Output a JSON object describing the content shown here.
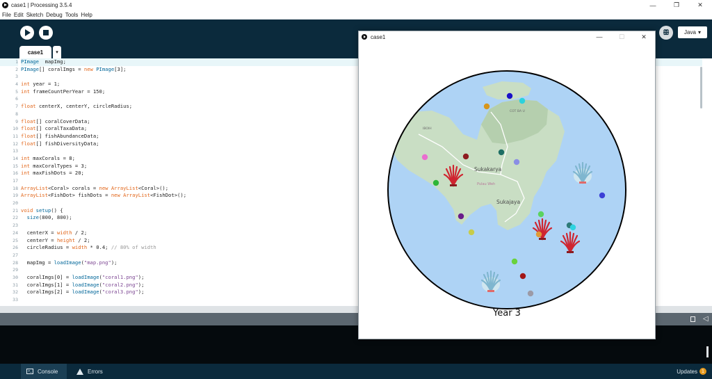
{
  "window": {
    "title": "case1 | Processing 3.5.4",
    "minimize_glyph": "—",
    "maximize_glyph": "❐",
    "close_glyph": "✕"
  },
  "menu": [
    "File",
    "Edit",
    "Sketch",
    "Debug",
    "Tools",
    "Help"
  ],
  "toolbar": {
    "run_icon": "play-icon",
    "stop_icon": "stop-icon",
    "debug_icon": "butterfly-icon",
    "mode_label": "Java",
    "mode_arrow": "▾"
  },
  "tabs": {
    "active": "case1",
    "menu_arrow": "▾"
  },
  "editor": {
    "current_line": 1,
    "lines": [
      {
        "n": "1",
        "s": [
          [
            "kw2",
            "PImage"
          ],
          [
            "",
            "  mapImg;"
          ]
        ]
      },
      {
        "n": "2",
        "s": [
          [
            "kw2",
            "PImage"
          ],
          [
            "",
            "[] coralImgs = "
          ],
          [
            "kw",
            "new"
          ],
          [
            "",
            " "
          ],
          [
            "kw2",
            "PImage"
          ],
          [
            "",
            "[3];"
          ]
        ]
      },
      {
        "n": "3",
        "s": []
      },
      {
        "n": "4",
        "s": [
          [
            "kw",
            "int"
          ],
          [
            "",
            " year = 1;"
          ]
        ]
      },
      {
        "n": "5",
        "s": [
          [
            "kw",
            "int"
          ],
          [
            "",
            " frameCountPerYear = 150;"
          ]
        ]
      },
      {
        "n": "6",
        "s": []
      },
      {
        "n": "7",
        "s": [
          [
            "kw",
            "float"
          ],
          [
            "",
            " centerX, centerY, circleRadius;"
          ]
        ]
      },
      {
        "n": "8",
        "s": []
      },
      {
        "n": "9",
        "s": [
          [
            "kw",
            "float"
          ],
          [
            "",
            "[] coralCoverData;"
          ]
        ]
      },
      {
        "n": "10",
        "s": [
          [
            "kw",
            "float"
          ],
          [
            "",
            "[] coralTaxaData;"
          ]
        ]
      },
      {
        "n": "11",
        "s": [
          [
            "kw",
            "float"
          ],
          [
            "",
            "[] fishAbundanceData;"
          ]
        ]
      },
      {
        "n": "12",
        "s": [
          [
            "kw",
            "float"
          ],
          [
            "",
            "[] fishDiversityData;"
          ]
        ]
      },
      {
        "n": "13",
        "s": []
      },
      {
        "n": "14",
        "s": [
          [
            "kw",
            "int"
          ],
          [
            "",
            " maxCorals = 8;"
          ]
        ]
      },
      {
        "n": "15",
        "s": [
          [
            "kw",
            "int"
          ],
          [
            "",
            " maxCoralTypes = 3;"
          ]
        ]
      },
      {
        "n": "16",
        "s": [
          [
            "kw",
            "int"
          ],
          [
            "",
            " maxFishDots = 20;"
          ]
        ]
      },
      {
        "n": "17",
        "s": []
      },
      {
        "n": "18",
        "s": [
          [
            "kw",
            "ArrayList"
          ],
          [
            "",
            "<Coral> corals = "
          ],
          [
            "kw",
            "new"
          ],
          [
            "",
            " "
          ],
          [
            "kw",
            "ArrayList"
          ],
          [
            "",
            "<Coral>();"
          ]
        ]
      },
      {
        "n": "19",
        "s": [
          [
            "kw",
            "ArrayList"
          ],
          [
            "",
            "<FishDot> fishDots = "
          ],
          [
            "kw",
            "new"
          ],
          [
            "",
            " "
          ],
          [
            "kw",
            "ArrayList"
          ],
          [
            "",
            "<FishDot>();"
          ]
        ]
      },
      {
        "n": "20",
        "s": []
      },
      {
        "n": "21",
        "s": [
          [
            "kw",
            "void"
          ],
          [
            "",
            " "
          ],
          [
            "fn",
            "setup"
          ],
          [
            "",
            "() {"
          ]
        ]
      },
      {
        "n": "22",
        "s": [
          [
            "",
            "  "
          ],
          [
            "fn",
            "size"
          ],
          [
            "",
            "(800, 800);"
          ]
        ]
      },
      {
        "n": "23",
        "s": []
      },
      {
        "n": "24",
        "s": [
          [
            "",
            "  centerX = "
          ],
          [
            "kw",
            "width"
          ],
          [
            "",
            " / 2;"
          ]
        ]
      },
      {
        "n": "25",
        "s": [
          [
            "",
            "  centerY = "
          ],
          [
            "kw",
            "height"
          ],
          [
            "",
            " / 2;"
          ]
        ]
      },
      {
        "n": "26",
        "s": [
          [
            "",
            "  circleRadius = "
          ],
          [
            "kw",
            "width"
          ],
          [
            "",
            " * 0.4; "
          ],
          [
            "cm",
            "// 80% of width"
          ]
        ]
      },
      {
        "n": "27",
        "s": []
      },
      {
        "n": "28",
        "s": [
          [
            "",
            "  mapImg = "
          ],
          [
            "fn",
            "loadImage"
          ],
          [
            "",
            "("
          ],
          [
            "str",
            "\"map.png\""
          ],
          [
            "",
            ");"
          ]
        ]
      },
      {
        "n": "29",
        "s": []
      },
      {
        "n": "30",
        "s": [
          [
            "",
            "  coralImgs[0] = "
          ],
          [
            "fn",
            "loadImage"
          ],
          [
            "",
            "("
          ],
          [
            "str",
            "\"coral1.png\""
          ],
          [
            "",
            ");"
          ]
        ]
      },
      {
        "n": "31",
        "s": [
          [
            "",
            "  coralImgs[1] = "
          ],
          [
            "fn",
            "loadImage"
          ],
          [
            "",
            "("
          ],
          [
            "str",
            "\"coral2.png\""
          ],
          [
            "",
            ");"
          ]
        ]
      },
      {
        "n": "32",
        "s": [
          [
            "",
            "  coralImgs[2] = "
          ],
          [
            "fn",
            "loadImage"
          ],
          [
            "",
            "("
          ],
          [
            "str",
            "\"coral3.png\""
          ],
          [
            "",
            ");"
          ]
        ]
      },
      {
        "n": "33",
        "s": []
      }
    ]
  },
  "status_icons": {
    "copy": "clipboard-icon",
    "collapse": "◁"
  },
  "bottom": {
    "console_label": "Console",
    "errors_label": "Errors",
    "updates_label": "Updates",
    "updates_count": "1"
  },
  "sketch": {
    "title": "case1",
    "year_label": "Year 3",
    "map_labels": [
      "Sukakarya",
      "Pulau Weh",
      "Sukajaya",
      "IBOIH",
      "COT BA U"
    ],
    "colors": {
      "ocean": "#aed3f5",
      "land": "#c9dec4",
      "land_dark": "#b5cfae",
      "road": "#ffffff",
      "coral": "#cf2530",
      "coral_blue": "#7fb6cf"
    },
    "fish_dots": [
      {
        "c": "#1a10c9"
      },
      {
        "c": "#2bd2dc"
      },
      {
        "c": "#d8951a"
      },
      {
        "c": "#1d6e64"
      },
      {
        "c": "#8e1c20"
      },
      {
        "c": "#ea6ed0"
      },
      {
        "c": "#8a8ee4"
      },
      {
        "c": "#2db637"
      },
      {
        "c": "#3b3fd6"
      },
      {
        "c": "#6a1b8a"
      },
      {
        "c": "#c8cc4a"
      },
      {
        "c": "#5bd35f"
      },
      {
        "c": "#2e7b78"
      },
      {
        "c": "#2ed3e0"
      },
      {
        "c": "#e09a38"
      },
      {
        "c": "#6ad23c"
      },
      {
        "c": "#a21616"
      },
      {
        "c": "#9c9aa6"
      }
    ],
    "corals": [
      {
        "kind": "red"
      },
      {
        "kind": "blue"
      },
      {
        "kind": "red"
      },
      {
        "kind": "red"
      },
      {
        "kind": "blue"
      }
    ]
  }
}
